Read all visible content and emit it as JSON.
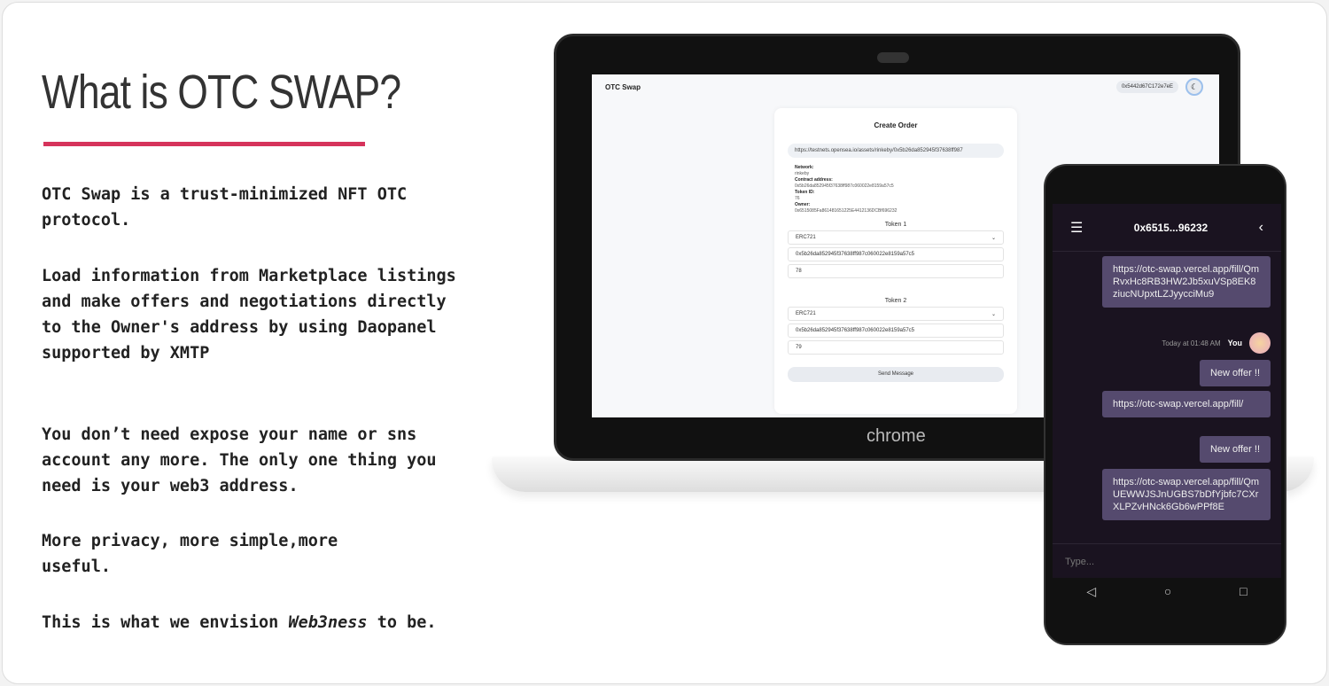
{
  "title": "What is OTC SWAP?",
  "paragraphs": [
    "OTC Swap is a trust-minimized NFT OTC protocol.",
    "Load information from Marketplace listings and make offers and negotiations directly to the Owner's address by using Daopanel supported by XMTP",
    "You don’t need expose your name or sns account any more. The only one thing you need is your web3 address.",
    "More privacy, more simple,more useful."
  ],
  "last_paragraph": {
    "before": "This is what we envision ",
    "em": "Web3ness",
    "after": " to be."
  },
  "laptop": {
    "brand": "chrome",
    "app_title": "OTC Swap",
    "wallet": "0x5442d67C172e7eE",
    "form": {
      "heading": "Create Order",
      "url": "https://testnets.opensea.io/assets/rinkeby/0x5b26da852945f37638ff987",
      "network_label": "Network:",
      "network": "rinkeby",
      "contract_label": "Contract address:",
      "contract": "0x5b26da852945f37638ff987c060022e8159a57c5",
      "token_id_label": "Token ID:",
      "token_id": "76",
      "owner_label": "Owner:",
      "owner": "0x6515085Fa861481651225E4412136DCBf696232",
      "token1": {
        "label": "Token 1",
        "standard": "ERC721",
        "address": "0x5b26da852945f37638ff987c060022e8159a57c5",
        "id": "78"
      },
      "token2": {
        "label": "Token 2",
        "standard": "ERC721",
        "address": "0x5b26da852945f37638ff987c060022e8159a57c5",
        "id": "79"
      },
      "send": "Send Message"
    }
  },
  "phone": {
    "header": "0x6515...96232",
    "messages": [
      "https://otc-swap.vercel.app/fill/QmRvxHc8RB3HW2Jb5xuVSp8EK8ziucNUpxtLZJyycciMu9",
      "New offer !!",
      "https://otc-swap.vercel.app/fill/",
      "New offer !!",
      "https://otc-swap.vercel.app/fill/QmUEWWJSJnUGBS7bDfYjbfc7CXrXLPZvHNck6Gb6wPPf8E"
    ],
    "time": "Today at 01:48 AM",
    "sender": "You",
    "placeholder": "Type..."
  },
  "colors": {
    "accent": "#d6335b",
    "bubble": "#554a6e"
  }
}
